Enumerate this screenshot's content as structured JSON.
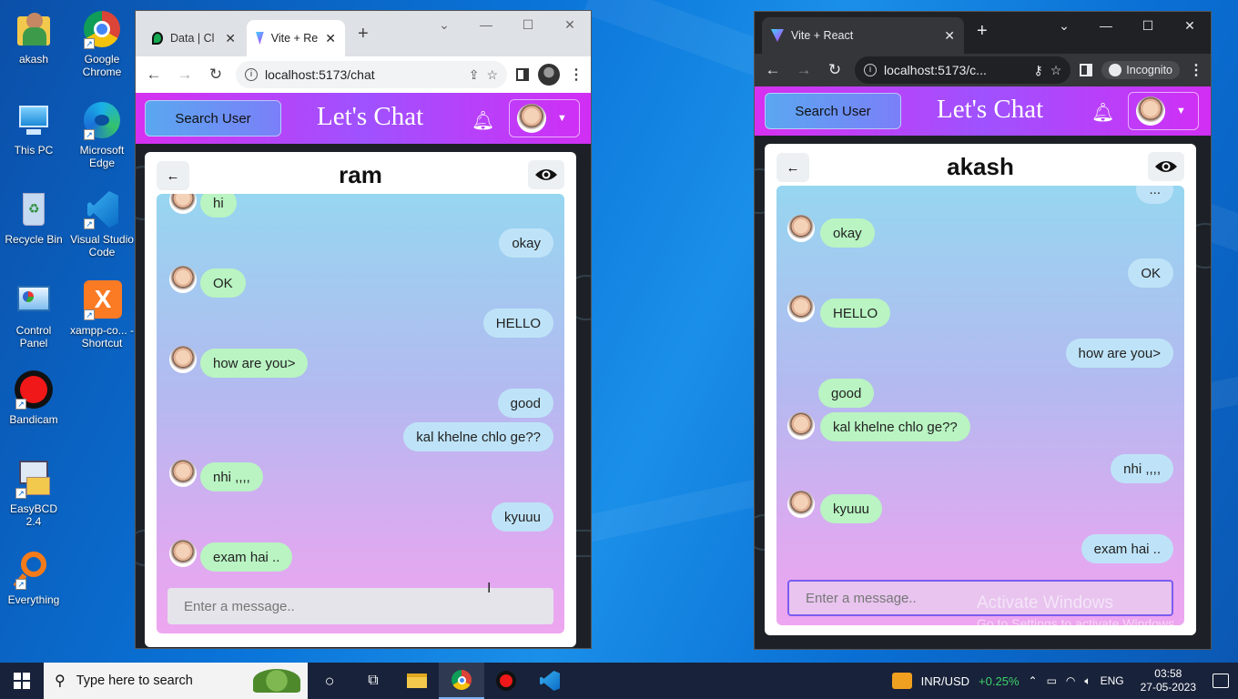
{
  "desktop": {
    "icons": [
      {
        "label": "akash"
      },
      {
        "label": "Google Chrome"
      },
      {
        "label": "This PC"
      },
      {
        "label": "Microsoft Edge"
      },
      {
        "label": "Recycle Bin"
      },
      {
        "label": "Visual Studio Code"
      },
      {
        "label": "Control Panel"
      },
      {
        "label": "xampp-co... - Shortcut"
      },
      {
        "label": "Bandicam"
      },
      {
        "label": "EasyBCD 2.4"
      },
      {
        "label": "Everything"
      }
    ],
    "watermark": {
      "title": "Activate Windows",
      "subtitle": "Go to Settings to activate Windows."
    }
  },
  "left_window": {
    "tabs": [
      {
        "label": "Data | Cl",
        "icon": "leaf-icon"
      },
      {
        "label": "Vite + Re",
        "icon": "vite-icon"
      }
    ],
    "url": "localhost:5173/chat",
    "app": {
      "search_label": "Search User",
      "brand": "Let's Chat"
    },
    "chat": {
      "name": "ram",
      "placeholder": "Enter a message..",
      "messages": [
        {
          "text": "hi",
          "dir": "in"
        },
        {
          "text": "okay",
          "dir": "out"
        },
        {
          "text": "OK",
          "dir": "in"
        },
        {
          "text": "HELLO",
          "dir": "out"
        },
        {
          "text": "how are you>",
          "dir": "in"
        },
        {
          "text": "good",
          "dir": "out"
        },
        {
          "text": "kal khelne chlo ge??",
          "dir": "out"
        },
        {
          "text": "nhi ,,,,",
          "dir": "in"
        },
        {
          "text": "kyuuu",
          "dir": "out"
        },
        {
          "text": "exam hai ..",
          "dir": "in"
        }
      ]
    }
  },
  "right_window": {
    "tabs": [
      {
        "label": "Vite + React",
        "icon": "vite-icon"
      }
    ],
    "url": "localhost:5173/c...",
    "incognito_label": "Incognito",
    "app": {
      "search_label": "Search User",
      "brand": "Let's Chat"
    },
    "chat": {
      "name": "akash",
      "placeholder": "Enter a message..",
      "messages": [
        {
          "text": "...",
          "dir": "out"
        },
        {
          "text": "okay",
          "dir": "in"
        },
        {
          "text": "OK",
          "dir": "out"
        },
        {
          "text": "HELLO",
          "dir": "in"
        },
        {
          "text": "how are you>",
          "dir": "out"
        },
        {
          "text": "good",
          "dir": "in"
        },
        {
          "text": "kal khelne chlo ge??",
          "dir": "in"
        },
        {
          "text": "nhi ,,,,",
          "dir": "out"
        },
        {
          "text": "kyuuu",
          "dir": "in"
        },
        {
          "text": "exam hai ..",
          "dir": "out"
        }
      ]
    }
  },
  "taskbar": {
    "search_placeholder": "Type here to search",
    "currency_label": "INR/USD",
    "currency_change": "+0.25%",
    "language": "ENG",
    "time": "03:58",
    "date": "27-05-2023"
  },
  "colors": {
    "header_gradient_start": "#d630f0",
    "incoming_bubble": "#b9f4c2",
    "outgoing_bubble": "#bee3f8",
    "taskbar": "#18223a"
  }
}
